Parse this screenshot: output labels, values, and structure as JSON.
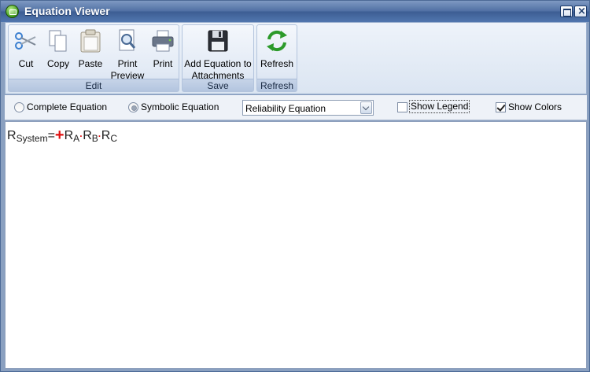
{
  "window": {
    "title": "Equation Viewer"
  },
  "ribbon": {
    "groups": [
      {
        "label": "Edit",
        "buttons": [
          {
            "label": "Cut",
            "icon": "scissors-icon"
          },
          {
            "label": "Copy",
            "icon": "copy-icon"
          },
          {
            "label": "Paste",
            "icon": "paste-icon"
          },
          {
            "label": "Print Preview",
            "icon": "print-preview-icon"
          },
          {
            "label": "Print",
            "icon": "printer-icon"
          }
        ]
      },
      {
        "label": "Save",
        "buttons": [
          {
            "label": "Add Equation to Attachments",
            "icon": "floppy-disk-icon"
          }
        ]
      },
      {
        "label": "Refresh",
        "buttons": [
          {
            "label": "Refresh",
            "icon": "refresh-icon"
          }
        ]
      }
    ]
  },
  "options": {
    "complete_equation": "Complete Equation",
    "symbolic_equation": "Symbolic Equation",
    "selected_mode": "Symbolic Equation",
    "equation_type": "Reliability Equation",
    "show_legend": {
      "label": "Show Legend",
      "checked": false
    },
    "show_colors": {
      "label": "Show Colors",
      "checked": true
    }
  },
  "equation": {
    "lhs": "R",
    "lhs_sub": "System",
    "equals": "=",
    "operator": "+",
    "terms": [
      {
        "base": "R",
        "sub": "A"
      },
      {
        "base": "R",
        "sub": "B"
      },
      {
        "base": "R",
        "sub": "C"
      }
    ],
    "separator": "·",
    "operator_color": "#e01010"
  },
  "colors": {
    "titlebar": "#4f6fa3",
    "ribbon_bg": "#dbe5f2"
  }
}
